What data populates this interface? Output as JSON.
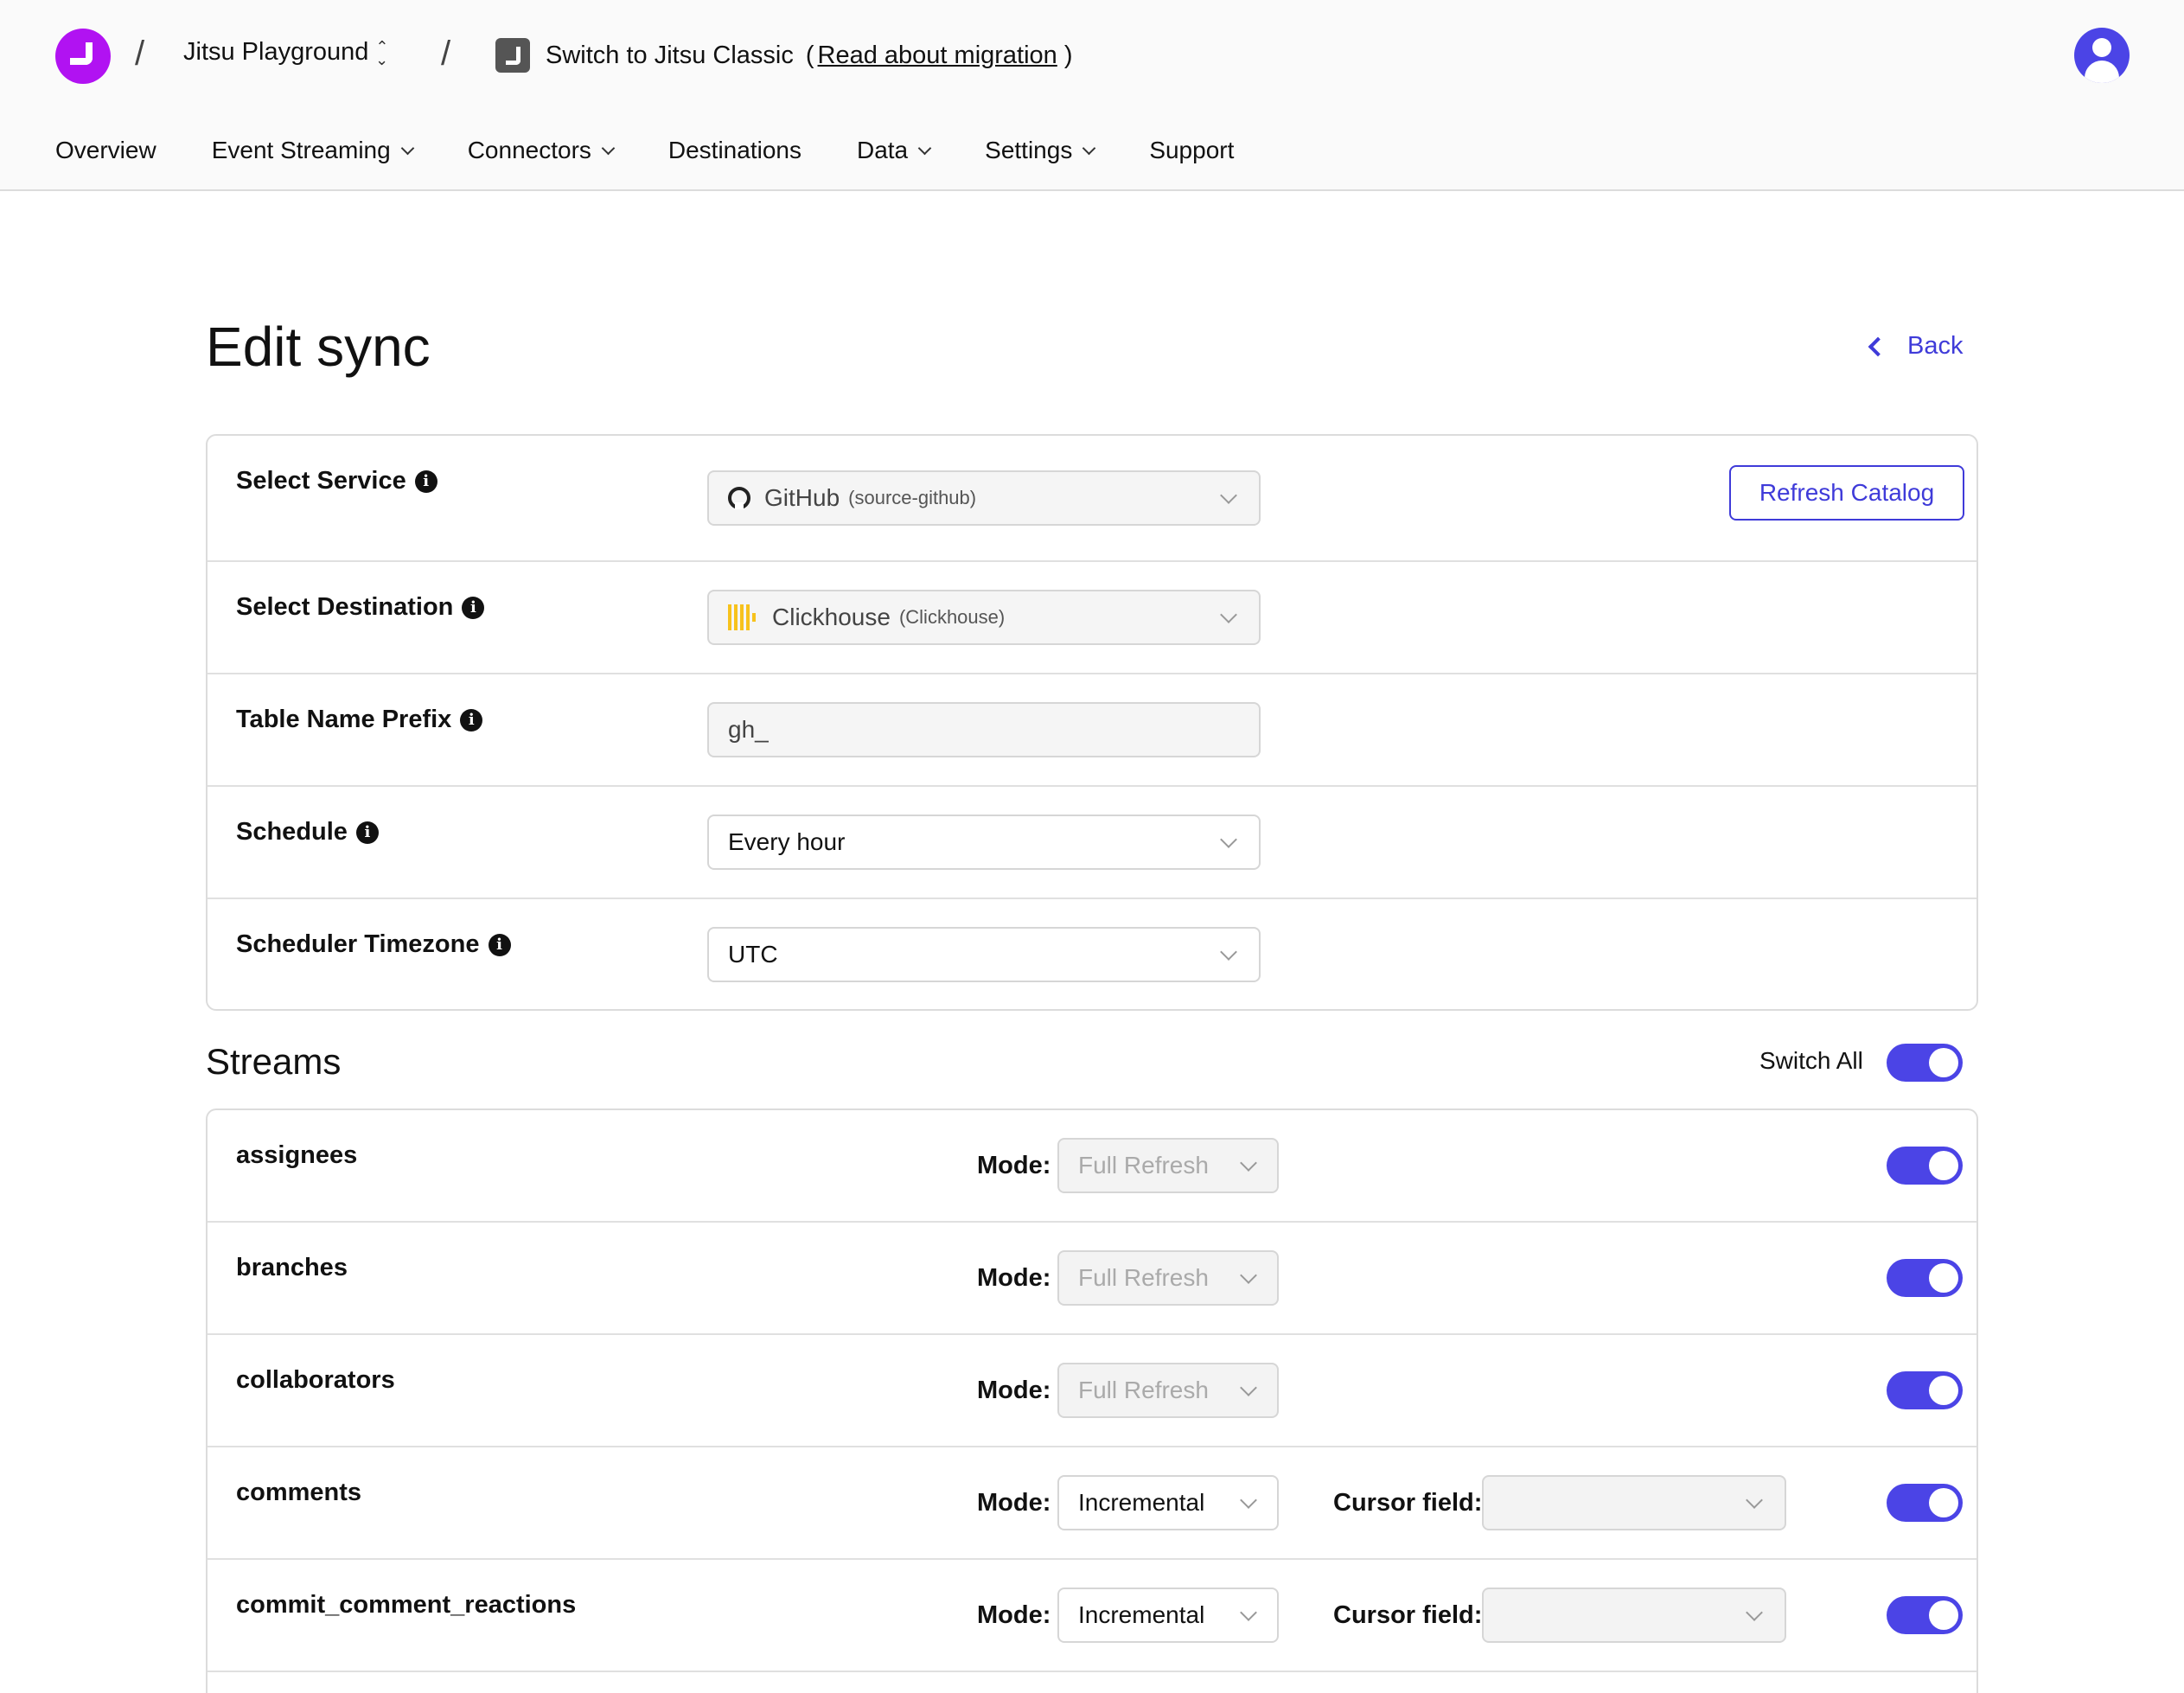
{
  "header": {
    "workspace": "Jitsu Playground",
    "classic_label": "Switch to Jitsu Classic",
    "open_paren": "(",
    "migration_link": "Read about migration",
    "close_paren": ")",
    "slash": "/"
  },
  "nav": [
    {
      "label": "Overview",
      "dropdown": false
    },
    {
      "label": "Event Streaming",
      "dropdown": true
    },
    {
      "label": "Connectors",
      "dropdown": true
    },
    {
      "label": "Destinations",
      "dropdown": false
    },
    {
      "label": "Data",
      "dropdown": true
    },
    {
      "label": "Settings",
      "dropdown": true
    },
    {
      "label": "Support",
      "dropdown": false
    }
  ],
  "page": {
    "title": "Edit sync",
    "back_label": "Back"
  },
  "settings": {
    "service_label": "Select Service",
    "service_value": "GitHub",
    "service_sub": "(source-github)",
    "refresh_label": "Refresh Catalog",
    "destination_label": "Select Destination",
    "destination_value": "Clickhouse",
    "destination_sub": "(Clickhouse)",
    "prefix_label": "Table Name Prefix",
    "prefix_value": "gh_",
    "schedule_label": "Schedule",
    "schedule_value": "Every hour",
    "timezone_label": "Scheduler Timezone",
    "timezone_value": "UTC",
    "info_glyph": "i"
  },
  "streams": {
    "title": "Streams",
    "switch_all_label": "Switch All",
    "switch_all_on": true,
    "mode_label": "Mode:",
    "cursor_label": "Cursor field:",
    "items": [
      {
        "name": "assignees",
        "mode": "Full Refresh",
        "mode_disabled": true,
        "has_cursor": false,
        "enabled": true
      },
      {
        "name": "branches",
        "mode": "Full Refresh",
        "mode_disabled": true,
        "has_cursor": false,
        "enabled": true
      },
      {
        "name": "collaborators",
        "mode": "Full Refresh",
        "mode_disabled": true,
        "has_cursor": false,
        "enabled": true
      },
      {
        "name": "comments",
        "mode": "Incremental",
        "mode_disabled": false,
        "has_cursor": true,
        "cursor_value": "",
        "enabled": true
      },
      {
        "name": "commit_comment_reactions",
        "mode": "Incremental",
        "mode_disabled": false,
        "has_cursor": true,
        "cursor_value": "",
        "enabled": true
      }
    ]
  },
  "colors": {
    "accent": "#4b44e6",
    "logo": "#b112f2",
    "clickhouse": "#f7c21c"
  }
}
